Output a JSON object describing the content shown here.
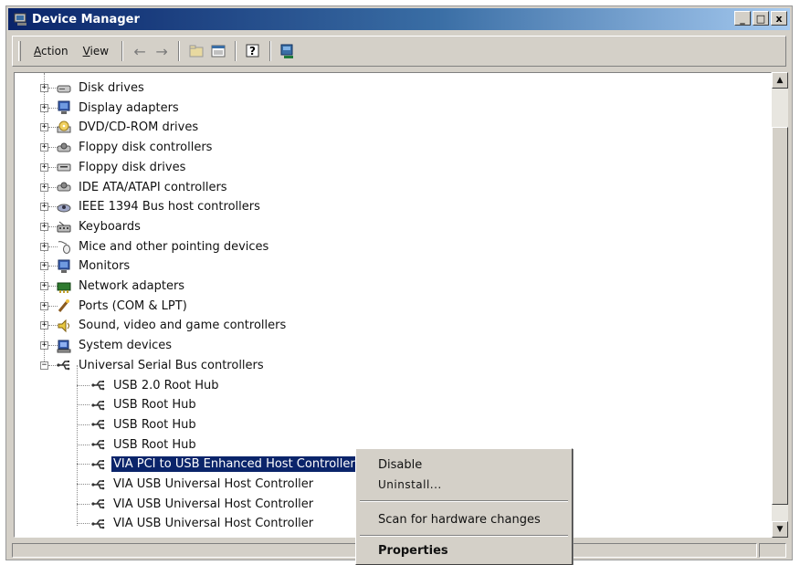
{
  "window": {
    "title": "Device Manager",
    "controls": [
      "_",
      "□",
      "x"
    ]
  },
  "menu": {
    "items": [
      {
        "label": "Action",
        "accel": "A"
      },
      {
        "label": "View",
        "accel": "V"
      }
    ]
  },
  "toolbar": {
    "buttons": [
      "back-arrow-icon",
      "forward-arrow-icon",
      "up-folder-icon",
      "properties-icon",
      "help-icon",
      "scan-hardware-icon"
    ]
  },
  "tree": {
    "categories": [
      {
        "label": "Disk drives",
        "icon": "disk-drive-icon"
      },
      {
        "label": "Display adapters",
        "icon": "monitor-icon"
      },
      {
        "label": "DVD/CD-ROM drives",
        "icon": "cdrom-icon"
      },
      {
        "label": "Floppy disk controllers",
        "icon": "controller-icon"
      },
      {
        "label": "Floppy disk drives",
        "icon": "floppy-drive-icon"
      },
      {
        "label": "IDE ATA/ATAPI controllers",
        "icon": "controller-icon"
      },
      {
        "label": "IEEE 1394 Bus host controllers",
        "icon": "bus-icon"
      },
      {
        "label": "Keyboards",
        "icon": "keyboard-icon"
      },
      {
        "label": "Mice and other pointing devices",
        "icon": "mouse-icon"
      },
      {
        "label": "Monitors",
        "icon": "monitor-icon"
      },
      {
        "label": "Network adapters",
        "icon": "network-icon"
      },
      {
        "label": "Ports (COM & LPT)",
        "icon": "port-icon"
      },
      {
        "label": "Sound, video and game controllers",
        "icon": "speaker-icon"
      },
      {
        "label": "System devices",
        "icon": "computer-icon"
      },
      {
        "label": "Universal Serial Bus controllers",
        "icon": "usb-icon",
        "expanded": true
      }
    ],
    "usb_children": [
      "USB 2.0 Root Hub",
      "USB Root Hub",
      "USB Root Hub",
      "USB Root Hub",
      "VIA PCI to USB Enhanced Host Controller",
      "VIA USB Universal Host Controller",
      "VIA USB Universal Host Controller",
      "VIA USB Universal Host Controller"
    ],
    "selected_child": "VIA PCI to USB Enhanced Host Controller"
  },
  "context_menu": {
    "disable": "Disable",
    "uninstall": "Uninstall...",
    "scan": "Scan for hardware changes",
    "properties": "Properties"
  },
  "colors": {
    "title_start": "#0a246a",
    "title_end": "#a6caf0",
    "selection": "#0a246a",
    "chrome": "#d4d0c8"
  }
}
